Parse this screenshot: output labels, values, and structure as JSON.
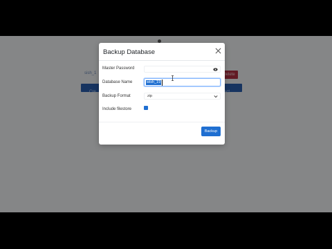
{
  "modal": {
    "title": "Backup Database",
    "fields": {
      "master_password": {
        "label": "Master Password",
        "value": ""
      },
      "database_name": {
        "label": "Database Name",
        "value": "wish_19"
      },
      "backup_format": {
        "label": "Backup Format",
        "value": "zip"
      },
      "include_filestore": {
        "label": "Include filestore",
        "checked": true
      }
    },
    "backup_label": "Backup"
  },
  "background": {
    "partial_text": "sish_1",
    "left_button_text": "Cre",
    "right_button_text": "ect",
    "red_button_text": "Delete"
  },
  "colors": {
    "primary": "#1f6fd1",
    "danger": "#b23142",
    "backdrop": "rgba(0,0,0,0.45)"
  }
}
